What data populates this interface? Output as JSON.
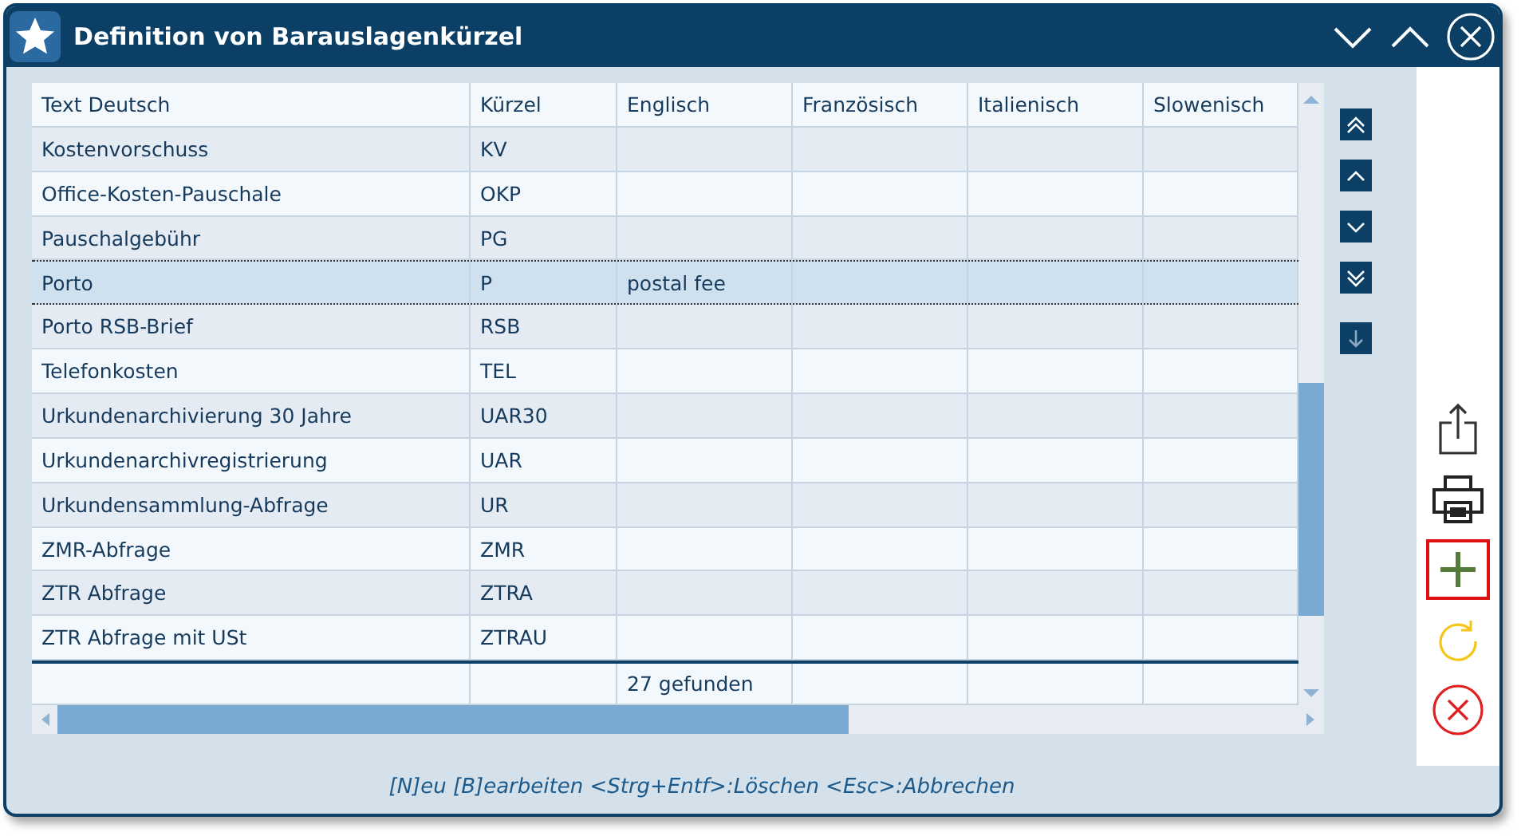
{
  "window": {
    "title": "Definition von Barauslagenkürzel"
  },
  "table": {
    "columns": [
      "Text Deutsch",
      "Kürzel",
      "Englisch",
      "Französisch",
      "Italienisch",
      "Slowenisch"
    ],
    "rows": [
      {
        "cells": [
          "Kostenvorschuss",
          "KV",
          "",
          "",
          "",
          ""
        ],
        "selected": false
      },
      {
        "cells": [
          "Office-Kosten-Pauschale",
          "OKP",
          "",
          "",
          "",
          ""
        ],
        "selected": false
      },
      {
        "cells": [
          "Pauschalgebühr",
          "PG",
          "",
          "",
          "",
          ""
        ],
        "selected": false
      },
      {
        "cells": [
          "Porto",
          "P",
          "postal fee",
          "",
          "",
          ""
        ],
        "selected": true
      },
      {
        "cells": [
          "Porto RSB-Brief",
          "RSB",
          "",
          "",
          "",
          ""
        ],
        "selected": false
      },
      {
        "cells": [
          "Telefonkosten",
          "TEL",
          "",
          "",
          "",
          ""
        ],
        "selected": false
      },
      {
        "cells": [
          "Urkundenarchivierung 30 Jahre",
          "UAR30",
          "",
          "",
          "",
          ""
        ],
        "selected": false
      },
      {
        "cells": [
          "Urkundenarchivregistrierung",
          "UAR",
          "",
          "",
          "",
          ""
        ],
        "selected": false
      },
      {
        "cells": [
          "Urkundensammlung-Abfrage",
          "UR",
          "",
          "",
          "",
          ""
        ],
        "selected": false
      },
      {
        "cells": [
          "ZMR-Abfrage",
          "ZMR",
          "",
          "",
          "",
          ""
        ],
        "selected": false
      },
      {
        "cells": [
          "ZTR Abfrage",
          "ZTRA",
          "",
          "",
          "",
          ""
        ],
        "selected": false
      },
      {
        "cells": [
          "ZTR Abfrage mit USt",
          "ZTRAU",
          "",
          "",
          "",
          ""
        ],
        "selected": false
      }
    ],
    "footer": {
      "result_count": "27 gefunden"
    }
  },
  "navigation": [
    {
      "kind": "first"
    },
    {
      "kind": "up"
    },
    {
      "kind": "down"
    },
    {
      "kind": "last"
    },
    {
      "kind": "end"
    }
  ],
  "tools": [
    {
      "kind": "export",
      "focused": false
    },
    {
      "kind": "print",
      "focused": false
    },
    {
      "kind": "add",
      "focused": true
    },
    {
      "kind": "refresh",
      "focused": false
    },
    {
      "kind": "cancel",
      "focused": false
    }
  ],
  "status_bar": "[N]eu [B]earbeiten <Strg+Entf>:Löschen <Esc>:Abbrechen"
}
